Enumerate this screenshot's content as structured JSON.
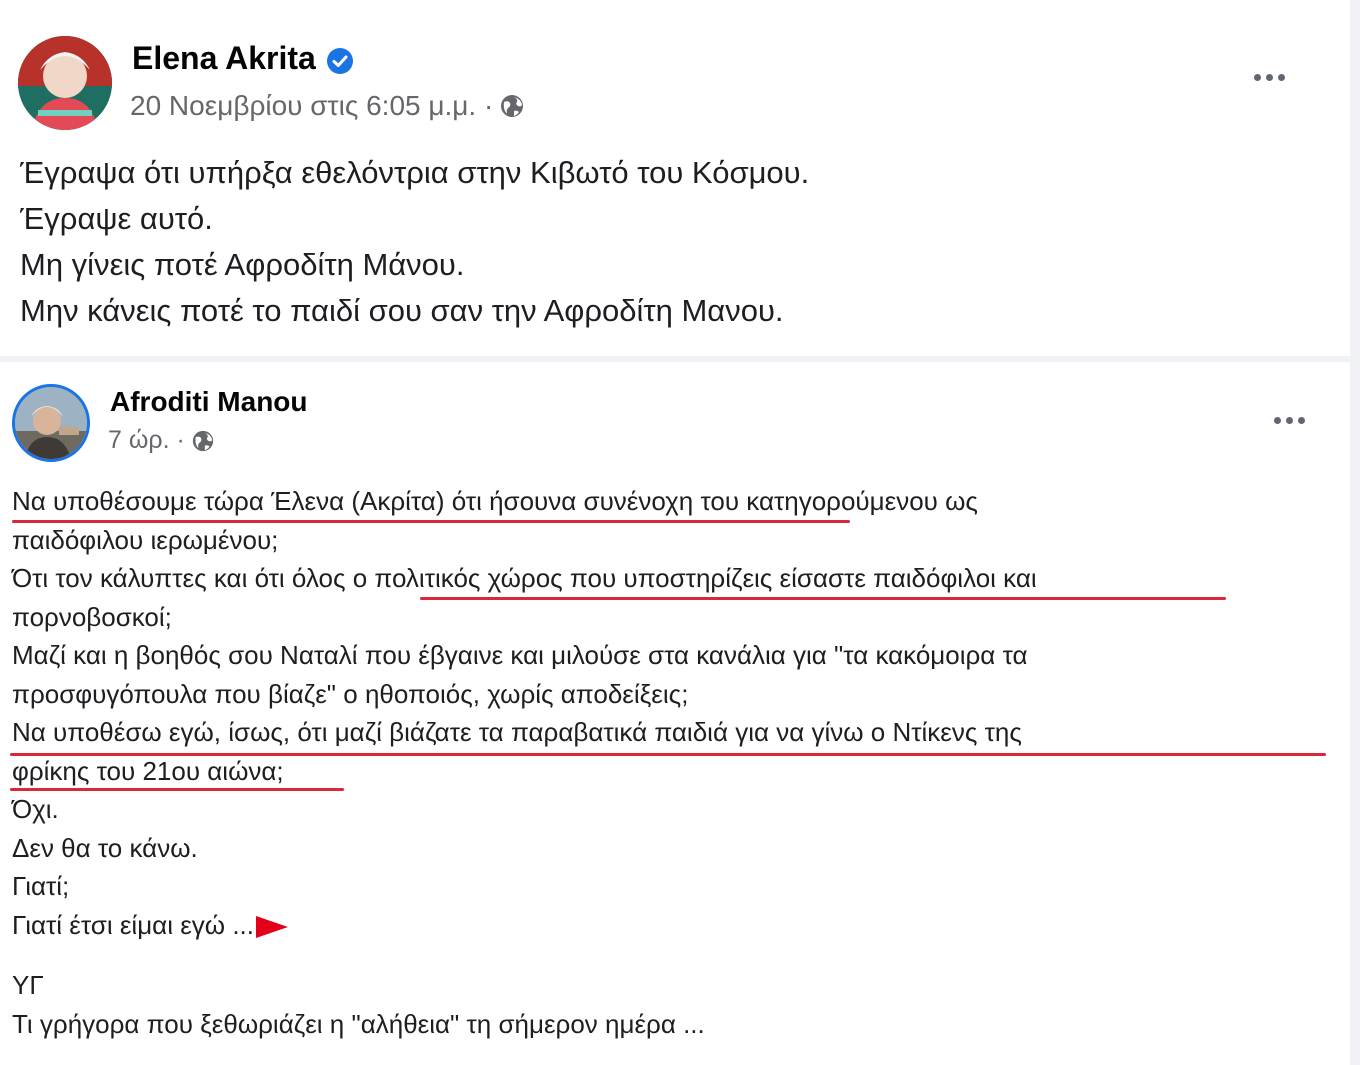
{
  "post1": {
    "author": "Elena Akrita",
    "verified": true,
    "timestamp": "20 Νοεμβρίου στις 6:05 μ.μ. ·",
    "audience_icon": "globe-icon",
    "menu_icon": "more-options-icon",
    "lines": [
      "Έγραψα ότι υπήρξα εθελόντρια στην Κιβωτό του Κόσμου.",
      "Έγραψε αυτό.",
      "Μη γίνεις ποτέ Αφροδίτη Μάνου.",
      "Μην κάνεις ποτέ το παιδί σου σαν την Αφροδίτη Μανου."
    ]
  },
  "post2": {
    "author": "Afroditi Manou",
    "timestamp": "7 ώρ. ·",
    "audience_icon": "globe-icon",
    "menu_icon": "more-options-icon",
    "lines": [
      "Να υποθέσουμε τώρα Έλενα (Ακρίτα) ότι ήσουνα συνένοχη του κατηγορούμενου ως",
      "παιδόφιλου ιερωμένου;",
      "Ότι τον κάλυπτες και ότι όλος ο πολιτικός χώρος που υποστηρίζεις είσαστε παιδόφιλοι και",
      "πορνοβοσκοί;",
      "Μαζί και η βοηθός σου Ναταλί που έβγαινε και μιλούσε στα κανάλια για \"τα κακόμοιρα τα",
      "προσφυγόπουλα που βίαζε\" ο ηθοποιός, χωρίς αποδείξεις;",
      "Να υποθέσω εγώ, ίσως, ότι μαζί βιάζατε τα παραβατικά παιδιά για να γίνω ο Ντίκενς της",
      "φρίκης του 21ου αιώνα;",
      "Όχι.",
      "Δεν θα το κάνω.",
      "Γιατί;",
      "Γιατί έτσι είμαι εγώ ..."
    ],
    "ps_lines": [
      "ΥΓ",
      "Τι γρήγορα που ξεθωριάζει η \"αλήθεια\" τη σήμερον ημέρα ..."
    ],
    "highlight_color": "#d8283a",
    "arrow_color": "#e3001b"
  }
}
